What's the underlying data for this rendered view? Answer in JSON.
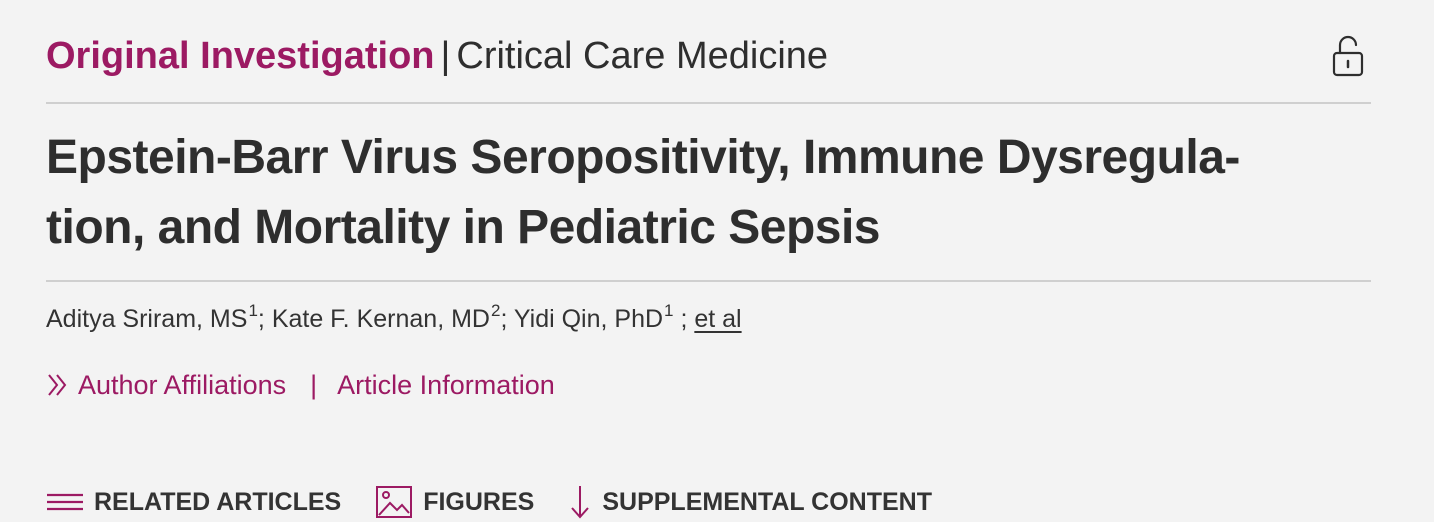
{
  "header": {
    "article_type": "Original Investigation",
    "separator": "|",
    "specialty": "Critical Care Medicine",
    "access_icon": "unlocked-padlock-icon"
  },
  "article": {
    "title": "Epstein-Barr Virus Seropositivity, Immune Dysregula-tion, and Mortality in Pediatric Sepsis",
    "title_lines": [
      "Epstein-Barr Virus Seropositivity, Immune Dysregula-",
      "tion, and Mortality in Pediatric Sepsis"
    ],
    "authors": [
      {
        "name": "Aditya Sriram, MS",
        "affiliation": "1"
      },
      {
        "name": "Kate F. Kernan, MD",
        "affiliation": "2"
      },
      {
        "name": "Yidi Qin, PhD",
        "affiliation": "1"
      }
    ],
    "et_al": "et al"
  },
  "links": {
    "author_affiliations": "Author Affiliations",
    "separator": "|",
    "article_information": "Article Information"
  },
  "tabs": [
    {
      "label": "RELATED ARTICLES",
      "icon": "hamburger-list-icon"
    },
    {
      "label": "FIGURES",
      "icon": "image-icon"
    },
    {
      "label": "SUPPLEMENTAL CONTENT",
      "icon": "download-arrow-icon"
    }
  ],
  "colors": {
    "accent": "#9c1a63",
    "text": "#2e2e2e",
    "background": "#f3f3f3",
    "rule": "#cfcfcf"
  }
}
